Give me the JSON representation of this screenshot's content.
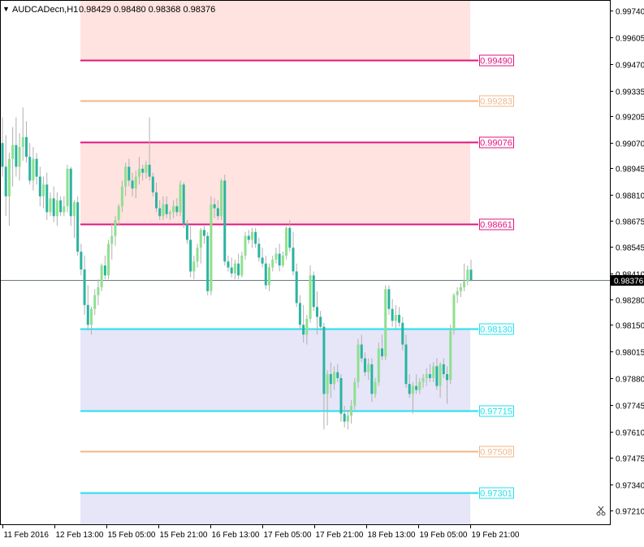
{
  "header": {
    "arrow_glyph": "▼",
    "symbol_tf": "AUDCADecn,H1",
    "ohlc": "0.98429 0.98480 0.98368 0.98376"
  },
  "chart_data": {
    "type": "candlestick",
    "symbol": "AUDCADecn",
    "timeframe": "H1",
    "ylim": [
      0.9714,
      0.9979
    ],
    "y_ticks": [
      "0.99740",
      "0.99605",
      "0.99470",
      "0.99335",
      "0.99205",
      "0.99070",
      "0.98945",
      "0.98810",
      "0.98675",
      "0.98545",
      "0.98410",
      "0.98280",
      "0.98150",
      "0.98015",
      "0.97880",
      "0.97745",
      "0.97610",
      "0.97475",
      "0.97340",
      "0.97210"
    ],
    "x_ticks": [
      "11 Feb 2016",
      "12 Feb 13:00",
      "15 Feb 05:00",
      "15 Feb 21:00",
      "16 Feb 13:00",
      "17 Feb 05:00",
      "17 Feb 21:00",
      "18 Feb 13:00",
      "19 Feb 05:00",
      "19 Feb 21:00"
    ],
    "current_price": "0.98376",
    "zones": [
      {
        "name": "supply-zone-upper",
        "from": 0.9949,
        "to": 0.9979,
        "color": "#ffe3e0"
      },
      {
        "name": "supply-zone-lower",
        "from": 0.98661,
        "to": 0.99076,
        "color": "#ffe3e0"
      },
      {
        "name": "demand-zone-upper",
        "from": 0.97715,
        "to": 0.9813,
        "color": "#e6e6f8"
      },
      {
        "name": "demand-zone-lower",
        "from": 0.9714,
        "to": 0.97301,
        "color": "#e6e6f8"
      }
    ],
    "levels": [
      {
        "label": "0.99490",
        "value": 0.9949,
        "color": "#e0157f"
      },
      {
        "label": "0.99283",
        "value": 0.99283,
        "color": "#f0b78a"
      },
      {
        "label": "0.99076",
        "value": 0.99076,
        "color": "#e0157f"
      },
      {
        "label": "0.98661",
        "value": 0.98661,
        "color": "#e0157f"
      },
      {
        "label": "0.98130",
        "value": 0.9813,
        "color": "#22e0ee"
      },
      {
        "label": "0.97715",
        "value": 0.97715,
        "color": "#22e0ee"
      },
      {
        "label": "0.97508",
        "value": 0.97508,
        "color": "#f0b78a"
      },
      {
        "label": "0.97301",
        "value": 0.97301,
        "color": "#22e0ee"
      }
    ],
    "bull_color": "#8ee08e",
    "bear_color": "#2bb3a0",
    "candles": [
      [
        0.9907,
        0.992,
        0.989,
        0.9895
      ],
      [
        0.9895,
        0.9911,
        0.987,
        0.988
      ],
      [
        0.988,
        0.9902,
        0.9865,
        0.9899
      ],
      [
        0.9899,
        0.9915,
        0.9885,
        0.9906
      ],
      [
        0.9906,
        0.992,
        0.989,
        0.9895
      ],
      [
        0.9895,
        0.9912,
        0.9888,
        0.9905
      ],
      [
        0.9905,
        0.9925,
        0.9898,
        0.991
      ],
      [
        0.991,
        0.9918,
        0.9897,
        0.99
      ],
      [
        0.99,
        0.9907,
        0.9886,
        0.9888
      ],
      [
        0.9888,
        0.9905,
        0.9883,
        0.9899
      ],
      [
        0.9899,
        0.9902,
        0.9886,
        0.989
      ],
      [
        0.989,
        0.9895,
        0.9875,
        0.988
      ],
      [
        0.988,
        0.989,
        0.9874,
        0.9886
      ],
      [
        0.9886,
        0.9892,
        0.9868,
        0.9872
      ],
      [
        0.9872,
        0.9882,
        0.987,
        0.9879
      ],
      [
        0.9879,
        0.9885,
        0.9867,
        0.987
      ],
      [
        0.987,
        0.9882,
        0.9865,
        0.9878
      ],
      [
        0.9878,
        0.988,
        0.987,
        0.9872
      ],
      [
        0.9872,
        0.988,
        0.987,
        0.9875
      ],
      [
        0.9875,
        0.9896,
        0.9872,
        0.9894
      ],
      [
        0.9894,
        0.9895,
        0.9865,
        0.987
      ],
      [
        0.987,
        0.9878,
        0.9859,
        0.9877
      ],
      [
        0.9877,
        0.988,
        0.985,
        0.9852
      ],
      [
        0.9852,
        0.9856,
        0.984,
        0.9843
      ],
      [
        0.9843,
        0.985,
        0.982,
        0.9825
      ],
      [
        0.9825,
        0.9835,
        0.9812,
        0.9815
      ],
      [
        0.9815,
        0.9824,
        0.981,
        0.9823
      ],
      [
        0.9823,
        0.9833,
        0.982,
        0.983
      ],
      [
        0.983,
        0.9838,
        0.9825,
        0.9834
      ],
      [
        0.9834,
        0.9846,
        0.9832,
        0.9845
      ],
      [
        0.9845,
        0.985,
        0.9838,
        0.984
      ],
      [
        0.984,
        0.9858,
        0.9838,
        0.9856
      ],
      [
        0.9856,
        0.9866,
        0.9848,
        0.986
      ],
      [
        0.986,
        0.987,
        0.9855,
        0.9868
      ],
      [
        0.9868,
        0.9876,
        0.9865,
        0.9875
      ],
      [
        0.9875,
        0.9888,
        0.9872,
        0.9885
      ],
      [
        0.9885,
        0.9897,
        0.988,
        0.9895
      ],
      [
        0.9895,
        0.9899,
        0.9885,
        0.9888
      ],
      [
        0.9888,
        0.9892,
        0.988,
        0.9884
      ],
      [
        0.9884,
        0.9893,
        0.9879,
        0.989
      ],
      [
        0.989,
        0.99,
        0.9886,
        0.9894
      ],
      [
        0.9894,
        0.9896,
        0.9888,
        0.9892
      ],
      [
        0.9892,
        0.9898,
        0.9889,
        0.9896
      ],
      [
        0.9896,
        0.992,
        0.9888,
        0.989
      ],
      [
        0.989,
        0.9892,
        0.988,
        0.9882
      ],
      [
        0.9882,
        0.9887,
        0.9872,
        0.9874
      ],
      [
        0.9874,
        0.9878,
        0.9868,
        0.987
      ],
      [
        0.987,
        0.988,
        0.9868,
        0.9876
      ],
      [
        0.9876,
        0.988,
        0.9869,
        0.9871
      ],
      [
        0.9871,
        0.9873,
        0.9868,
        0.9872
      ],
      [
        0.9872,
        0.9878,
        0.9869,
        0.9875
      ],
      [
        0.9875,
        0.9879,
        0.987,
        0.9872
      ],
      [
        0.9872,
        0.9888,
        0.987,
        0.9886
      ],
      [
        0.9886,
        0.9887,
        0.9864,
        0.9866
      ],
      [
        0.9866,
        0.9868,
        0.9856,
        0.9858
      ],
      [
        0.9858,
        0.9865,
        0.9839,
        0.9842
      ],
      [
        0.9842,
        0.985,
        0.9838,
        0.9847
      ],
      [
        0.9847,
        0.9856,
        0.9844,
        0.9854
      ],
      [
        0.9854,
        0.9864,
        0.9846,
        0.9863
      ],
      [
        0.9863,
        0.9865,
        0.9856,
        0.986
      ],
      [
        0.986,
        0.9862,
        0.983,
        0.9832
      ],
      [
        0.9832,
        0.988,
        0.983,
        0.9876
      ],
      [
        0.9876,
        0.9879,
        0.9869,
        0.9874
      ],
      [
        0.9874,
        0.9878,
        0.9868,
        0.987
      ],
      [
        0.987,
        0.9889,
        0.9868,
        0.9888
      ],
      [
        0.9888,
        0.9891,
        0.9845,
        0.9847
      ],
      [
        0.9847,
        0.985,
        0.9842,
        0.9844
      ],
      [
        0.9844,
        0.9849,
        0.9839,
        0.9841
      ],
      [
        0.9841,
        0.9848,
        0.9838,
        0.9846
      ],
      [
        0.9846,
        0.9851,
        0.9838,
        0.984
      ],
      [
        0.984,
        0.9852,
        0.9839,
        0.985
      ],
      [
        0.985,
        0.9862,
        0.9848,
        0.986
      ],
      [
        0.986,
        0.9863,
        0.9856,
        0.9858
      ],
      [
        0.9858,
        0.9864,
        0.9854,
        0.9862
      ],
      [
        0.9862,
        0.9864,
        0.9854,
        0.9856
      ],
      [
        0.9856,
        0.9859,
        0.9847,
        0.9849
      ],
      [
        0.9849,
        0.9854,
        0.9844,
        0.9846
      ],
      [
        0.9846,
        0.985,
        0.9833,
        0.9835
      ],
      [
        0.9835,
        0.9846,
        0.9832,
        0.9844
      ],
      [
        0.9844,
        0.985,
        0.9842,
        0.9848
      ],
      [
        0.9848,
        0.9854,
        0.9846,
        0.9851
      ],
      [
        0.9851,
        0.9856,
        0.9842,
        0.9845
      ],
      [
        0.9845,
        0.9852,
        0.9844,
        0.985
      ],
      [
        0.985,
        0.9865,
        0.9848,
        0.9864
      ],
      [
        0.9864,
        0.9868,
        0.9852,
        0.9854
      ],
      [
        0.9854,
        0.9862,
        0.984,
        0.9842
      ],
      [
        0.9842,
        0.9846,
        0.9824,
        0.9826
      ],
      [
        0.9826,
        0.983,
        0.9813,
        0.9815
      ],
      [
        0.9815,
        0.9825,
        0.9806,
        0.981
      ],
      [
        0.981,
        0.982,
        0.9805,
        0.9818
      ],
      [
        0.9818,
        0.9845,
        0.9816,
        0.984
      ],
      [
        0.984,
        0.9842,
        0.9822,
        0.9824
      ],
      [
        0.9824,
        0.9832,
        0.981,
        0.9819
      ],
      [
        0.9819,
        0.9822,
        0.9812,
        0.9814
      ],
      [
        0.9814,
        0.9816,
        0.9762,
        0.978
      ],
      [
        0.978,
        0.9792,
        0.9764,
        0.979
      ],
      [
        0.979,
        0.9796,
        0.9778,
        0.9785
      ],
      [
        0.9785,
        0.9794,
        0.9782,
        0.9791
      ],
      [
        0.9791,
        0.9795,
        0.9786,
        0.9788
      ],
      [
        0.9788,
        0.979,
        0.9766,
        0.977
      ],
      [
        0.977,
        0.9774,
        0.9763,
        0.9766
      ],
      [
        0.9766,
        0.9772,
        0.9762,
        0.9769
      ],
      [
        0.9769,
        0.9777,
        0.9765,
        0.9774
      ],
      [
        0.9774,
        0.9788,
        0.9772,
        0.9786
      ],
      [
        0.9786,
        0.9808,
        0.9783,
        0.9805
      ],
      [
        0.9805,
        0.981,
        0.9796,
        0.9798
      ],
      [
        0.9798,
        0.9801,
        0.9789,
        0.9791
      ],
      [
        0.9791,
        0.9798,
        0.9787,
        0.9795
      ],
      [
        0.9795,
        0.9798,
        0.9776,
        0.978
      ],
      [
        0.978,
        0.9788,
        0.9778,
        0.9786
      ],
      [
        0.9786,
        0.9806,
        0.9784,
        0.9803
      ],
      [
        0.9803,
        0.981,
        0.9797,
        0.9799
      ],
      [
        0.9799,
        0.9835,
        0.9797,
        0.9833
      ],
      [
        0.9833,
        0.9835,
        0.982,
        0.9823
      ],
      [
        0.9823,
        0.9828,
        0.9814,
        0.9817
      ],
      [
        0.9817,
        0.9825,
        0.9813,
        0.982
      ],
      [
        0.982,
        0.9824,
        0.9814,
        0.9816
      ],
      [
        0.9816,
        0.9819,
        0.9802,
        0.9805
      ],
      [
        0.9805,
        0.981,
        0.9783,
        0.9785
      ],
      [
        0.9785,
        0.979,
        0.9778,
        0.978
      ],
      [
        0.978,
        0.9786,
        0.977,
        0.9784
      ],
      [
        0.9784,
        0.979,
        0.978,
        0.9782
      ],
      [
        0.9782,
        0.9788,
        0.978,
        0.9786
      ],
      [
        0.9786,
        0.979,
        0.9783,
        0.9788
      ],
      [
        0.9788,
        0.9793,
        0.9784,
        0.979
      ],
      [
        0.979,
        0.9795,
        0.9786,
        0.9788
      ],
      [
        0.9788,
        0.9796,
        0.9786,
        0.9794
      ],
      [
        0.9794,
        0.9798,
        0.9782,
        0.9784
      ],
      [
        0.9784,
        0.9796,
        0.9778,
        0.9795
      ],
      [
        0.9795,
        0.9798,
        0.9788,
        0.979
      ],
      [
        0.979,
        0.9794,
        0.9775,
        0.9787
      ],
      [
        0.9787,
        0.9815,
        0.9785,
        0.9812
      ],
      [
        0.9812,
        0.9831,
        0.981,
        0.983
      ],
      [
        0.983,
        0.9834,
        0.9826,
        0.9832
      ],
      [
        0.9832,
        0.9836,
        0.9829,
        0.9834
      ],
      [
        0.9834,
        0.9846,
        0.9832,
        0.9837
      ],
      [
        0.9837,
        0.9845,
        0.9835,
        0.98429
      ],
      [
        0.98429,
        0.9848,
        0.98368,
        0.98376
      ]
    ]
  }
}
